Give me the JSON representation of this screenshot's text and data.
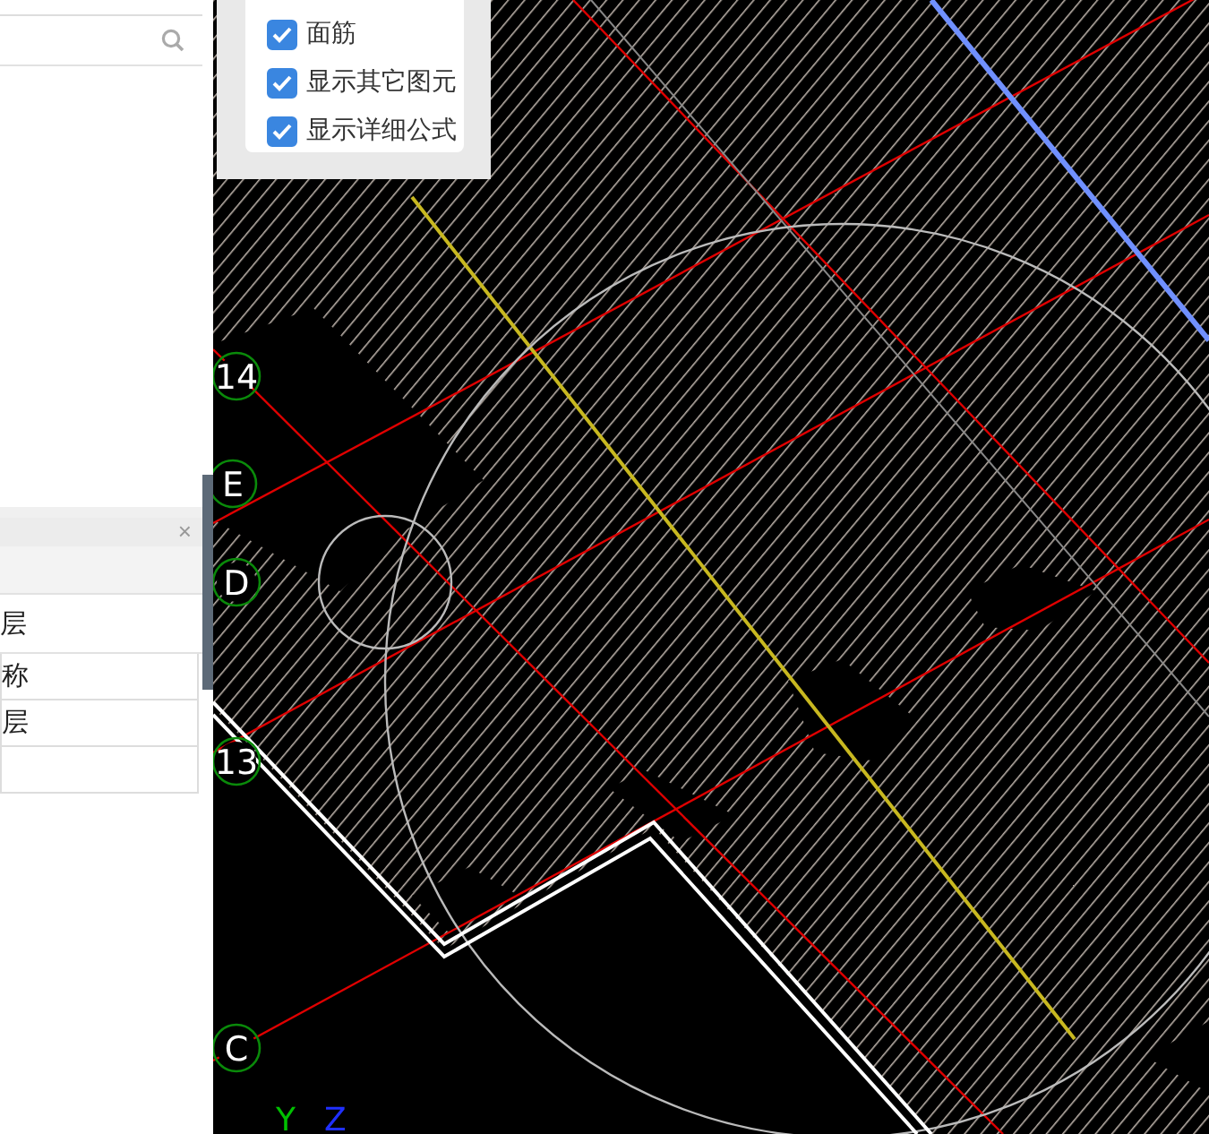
{
  "options_popup": {
    "items": [
      {
        "label": "面筋",
        "checked": true
      },
      {
        "label": "显示其它图元",
        "checked": true
      },
      {
        "label": "显示详细公式",
        "checked": true
      }
    ]
  },
  "properties_panel": {
    "close": "×",
    "heading": "层",
    "rows": [
      "称",
      "层"
    ]
  },
  "canvas": {
    "grid_labels": [
      "14",
      "E",
      "D",
      "13",
      "C"
    ],
    "axes": [
      "Y",
      "Z"
    ]
  }
}
